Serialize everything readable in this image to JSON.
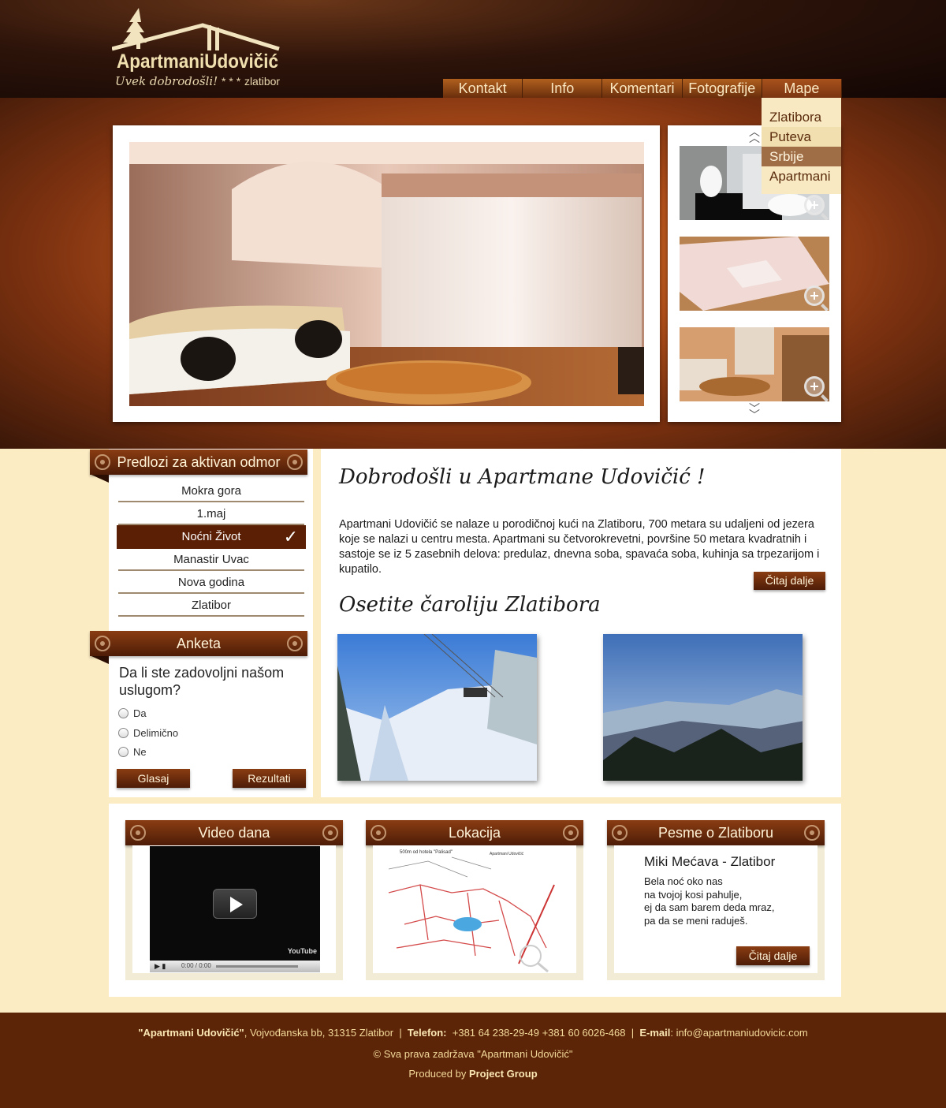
{
  "brand": {
    "name": "ApartmaniUdovičić",
    "tagline": "Uvek dobrodošli!",
    "stars": "* * *",
    "place": "zlatibor"
  },
  "nav": {
    "items": [
      "Kontakt",
      "Info",
      "Komentari",
      "Fotografije",
      "Mape"
    ],
    "dropdown": [
      "Zlatibora",
      "Puteva",
      "Srbije",
      "Apartmani"
    ]
  },
  "sidebar": {
    "title": "Predlozi za aktivan odmor",
    "items": [
      "Mokra gora",
      "1.maj",
      "Noćni Život",
      "Manastir Uvac",
      "Nova godina",
      "Zlatibor"
    ]
  },
  "poll": {
    "title": "Anketa",
    "question": "Da li ste zadovoljni našom uslugom?",
    "options": [
      "Da",
      "Delimično",
      "Ne"
    ],
    "vote_label": "Glasaj",
    "results_label": "Rezultati"
  },
  "welcome": {
    "title": "Dobrodošli u Apartmane Udovičić !",
    "text": "Apartmani Udovičić se nalaze u porodičnoj kući na Zlatiboru, 700 metara su udaljeni od jezera koje se nalazi u centru mesta. Apartmani su četvorokrevetni, površine 50 metara kvadratnih i sastoje se iz 5 zasebnih delova: predulaz, dnevna soba, spavaća soba, kuhinja sa trpezarijom i kupatilo.",
    "read_more": "Čitaj dalje",
    "subtitle": "Osetite čaroliju Zlatibora"
  },
  "widgets": {
    "video_title": "Video dana",
    "video_time": "0:00 / 0:00",
    "video_brand": "YouTube",
    "map_title": "Lokacija",
    "map_caption": "500m od hotela \"Palisad\"",
    "map_legend_title": "Apartmani Udovičić",
    "song_box_title": "Pesme o Zlatiboru",
    "song_title": "Miki Mećava - Zlatibor",
    "song_lines": [
      "Bela noć oko nas",
      "na tvojoj kosi pahulje,",
      "ej da sam barem deda mraz,",
      "pa da se meni raduješ."
    ],
    "song_read_more": "Čitaj dalje"
  },
  "footer": {
    "company": "\"Apartmani Udovičić\"",
    "address": ", Vojvođanska bb, 31315 Zlatibor",
    "phone_label": "Telefon:",
    "phones": "+381 64 238-29-49  +381 60 6026-468",
    "email_label": "E-mail",
    "email": ": info@apartmaniudovicic.com",
    "copyright": "© Sva prava zadržava \"Apartmani Udovičić\"",
    "produced_by": "Produced by ",
    "producer": "Project Group"
  },
  "colors": {
    "brown_dark": "#5c2508",
    "orange_glow": "#d9782a",
    "cream": "#fcecc4"
  }
}
